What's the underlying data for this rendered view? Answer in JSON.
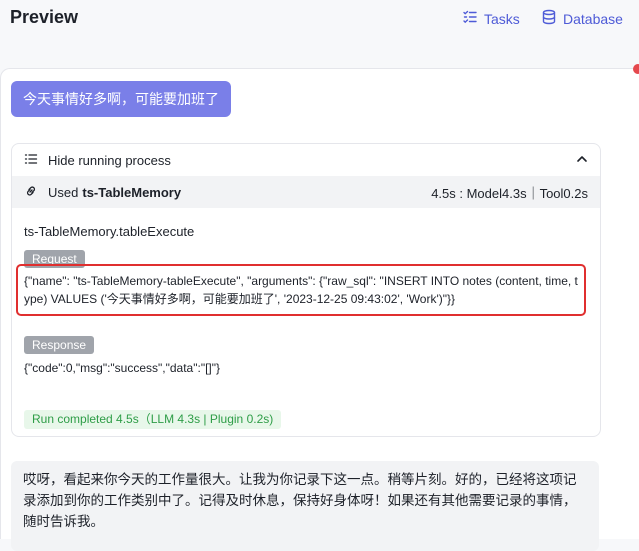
{
  "header": {
    "title": "Preview",
    "tasks_label": "Tasks",
    "database_label": "Database"
  },
  "chat": {
    "user_message": "今天事情好多啊，可能要加班了",
    "process": {
      "toggle_label": "Hide running process",
      "used_prefix": "Used",
      "tool": "ts-TableMemory",
      "timing": "4.5s : Model4.3s｜Tool0.2s",
      "call_name": "ts-TableMemory.tableExecute",
      "request_tag": "Request",
      "request_body": "{\"name\": \"ts-TableMemory-tableExecute\", \"arguments\": {\"raw_sql\": \"INSERT INTO notes (content, time, type) VALUES ('今天事情好多啊，可能要加班了', '2023-12-25 09:43:02', 'Work')\"}}",
      "response_tag": "Response",
      "response_body": "{\"code\":0,\"msg\":\"success\",\"data\":\"[]\"}",
      "run_status": "Run completed 4.5s（LLM 4.3s | Plugin 0.2s)"
    },
    "assistant_message": "哎呀，看起来你今天的工作量很大。让我为你记录下这一点。稍等片刻。好的，已经将这项记录添加到你的工作类别中了。记得及时休息，保持好身体呀！如果还有其他需要记录的事情，随时告诉我。"
  },
  "colors": {
    "accent": "#4e5bd7",
    "user_bubble": "#7a7fe8",
    "highlight": "#e02f2f",
    "success": "#2e9d47"
  }
}
